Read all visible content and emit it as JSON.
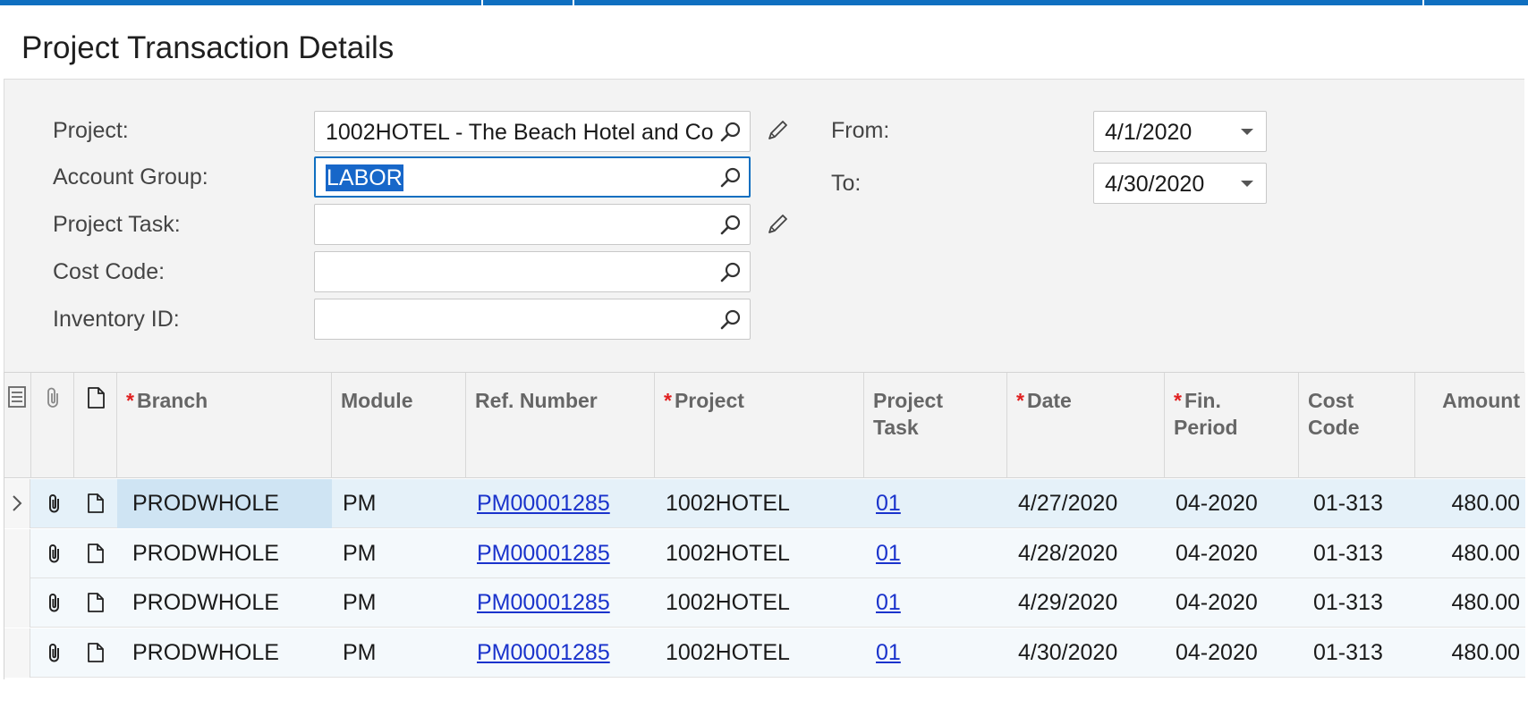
{
  "page": {
    "title": "Project Transaction Details"
  },
  "filters": {
    "project": {
      "label": "Project:",
      "value": "1002HOTEL - The Beach Hotel and Co"
    },
    "account_group": {
      "label": "Account Group:",
      "value": "LABOR"
    },
    "project_task": {
      "label": "Project Task:",
      "value": ""
    },
    "cost_code": {
      "label": "Cost Code:",
      "value": ""
    },
    "inventory_id": {
      "label": "Inventory ID:",
      "value": ""
    },
    "from": {
      "label": "From:",
      "value": "4/1/2020"
    },
    "to": {
      "label": "To:",
      "value": "4/30/2020"
    }
  },
  "grid": {
    "columns": {
      "branch": {
        "label": "Branch",
        "required": true
      },
      "module": {
        "label": "Module"
      },
      "ref_number": {
        "label": "Ref. Number"
      },
      "project": {
        "label": "Project",
        "required": true
      },
      "project_task": {
        "label": "Project Task"
      },
      "date": {
        "label": "Date",
        "required": true
      },
      "fin_period": {
        "label": "Fin. Period",
        "required": true
      },
      "cost_code": {
        "label": "Cost Code"
      },
      "amount": {
        "label": "Amount"
      }
    },
    "rows": [
      {
        "branch": "PRODWHOLE",
        "module": "PM",
        "ref_number": "PM00001285",
        "project": "1002HOTEL",
        "project_task": "01",
        "date": "4/27/2020",
        "fin_period": "04-2020",
        "cost_code": "01-313",
        "amount": "480.00"
      },
      {
        "branch": "PRODWHOLE",
        "module": "PM",
        "ref_number": "PM00001285",
        "project": "1002HOTEL",
        "project_task": "01",
        "date": "4/28/2020",
        "fin_period": "04-2020",
        "cost_code": "01-313",
        "amount": "480.00"
      },
      {
        "branch": "PRODWHOLE",
        "module": "PM",
        "ref_number": "PM00001285",
        "project": "1002HOTEL",
        "project_task": "01",
        "date": "4/29/2020",
        "fin_period": "04-2020",
        "cost_code": "01-313",
        "amount": "480.00"
      },
      {
        "branch": "PRODWHOLE",
        "module": "PM",
        "ref_number": "PM00001285",
        "project": "1002HOTEL",
        "project_task": "01",
        "date": "4/30/2020",
        "fin_period": "04-2020",
        "cost_code": "01-313",
        "amount": "480.00"
      }
    ]
  },
  "colors": {
    "accent": "#0f6fc0",
    "selection": "#1767c9",
    "link": "#1a33cc",
    "required_mark": "#e02020"
  },
  "icons": [
    "search-icon",
    "pencil-icon",
    "dropdown-caret-icon",
    "row-settings-icon",
    "paperclip-icon",
    "document-icon",
    "chevron-right-icon"
  ]
}
